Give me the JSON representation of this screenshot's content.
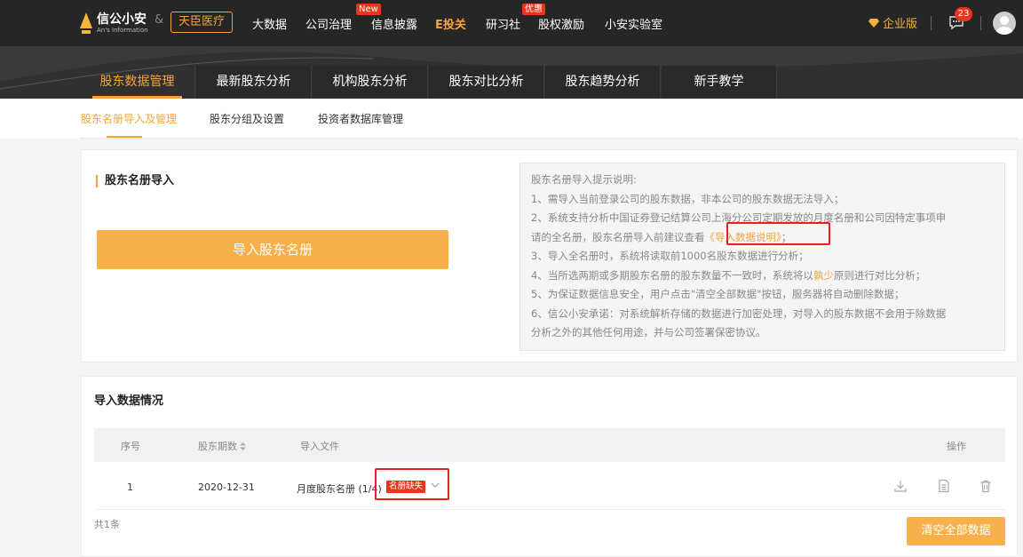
{
  "header": {
    "logo_cn": "信公小安",
    "logo_en": "An's Information",
    "amp": "&",
    "client_name": "天臣医疗",
    "nav": [
      {
        "label": "大数据",
        "tag": ""
      },
      {
        "label": "公司治理",
        "tag": "New"
      },
      {
        "label": "信息披露",
        "tag": ""
      },
      {
        "label": "E投关",
        "tag": ""
      },
      {
        "label": "研习社",
        "tag": "优惠"
      },
      {
        "label": "股权激励",
        "tag": ""
      },
      {
        "label": "小安实验室",
        "tag": ""
      }
    ],
    "enterprise_label": "企业版",
    "message_count": "23",
    "colors": {
      "accent": "#f4a53a",
      "badge": "#e8361c",
      "bg": "#262626"
    }
  },
  "main_tabs": [
    "股东数据管理",
    "最新股东分析",
    "机构股东分析",
    "股东对比分析",
    "股东趋势分析",
    "新手教学"
  ],
  "sub_tabs": [
    "股东名册导入及管理",
    "股东分组及设置",
    "投资者数据库管理"
  ],
  "import_card": {
    "title": "股东名册导入",
    "button_label": "导入股东名册",
    "notes": {
      "heading": "股东名册导入提示说明:",
      "line1": "1、需导入当前登录公司的股东数据，非本公司的股东数据无法导入；",
      "line2a": "2、系统支持分析中国证券登记结算公司上海分公司定期发放的月度名册和公司因特定事项申",
      "line2b": "请的全名册，股东名册导入前建议查看",
      "line2_link": "《导入数据说明》",
      "line2_end": "；",
      "line3": "3、导入全名册时，系统将读取前1000名股东数据进行分析；",
      "line4a": "4、当所选两期或多期股东名册的股东数量不一致时，系统将以",
      "line4_hl": "孰少",
      "line4b": "原则进行对比分析；",
      "line5": "5、为保证数据信息安全，用户点击\"清空全部数据\"按钮，服务器将自动删除数据；",
      "line6a": "6、信公小安承诺：对系统解析存储的数据进行加密处理，对导入的股东数据不会用于除数据",
      "line6b": "分析之外的其他任何用途，并与公司签署保密协议。"
    }
  },
  "data_card": {
    "title": "导入数据情况",
    "columns": {
      "index": "序号",
      "period": "股东期数",
      "file": "导入文件",
      "ops": "操作"
    },
    "rows": [
      {
        "index": "1",
        "period": "2020-12-31",
        "file": "月度股东名册 (1/4)",
        "status": "名册缺失"
      }
    ],
    "total": "共1条",
    "clear_label": "清空全部数据"
  }
}
